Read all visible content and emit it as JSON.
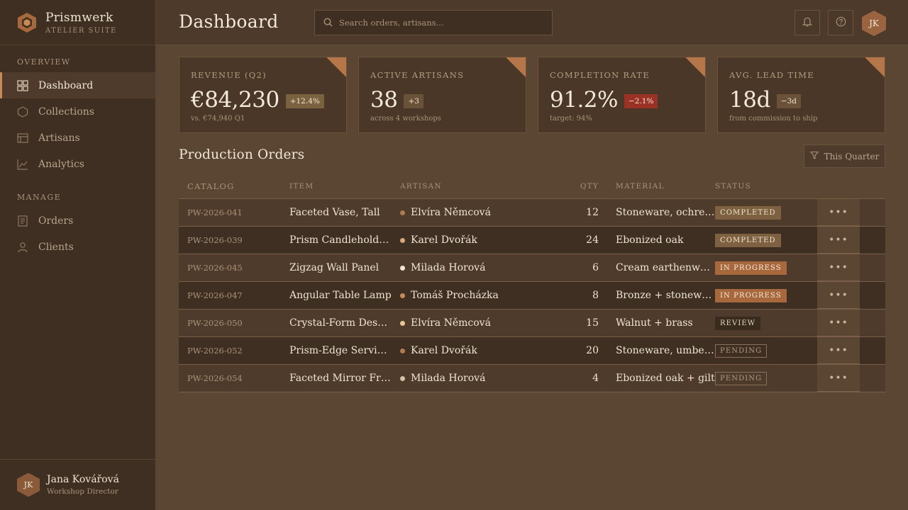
{
  "brand": {
    "name": "Prismwerk",
    "subtitle": "ATELIER SUITE"
  },
  "nav": {
    "overview_label": "OVERVIEW",
    "manage_label": "MANAGE",
    "items": [
      {
        "label": "Dashboard",
        "icon": "grid-icon",
        "active": true
      },
      {
        "label": "Collections",
        "icon": "hexagon-icon"
      },
      {
        "label": "Artisans",
        "icon": "layout-icon"
      },
      {
        "label": "Analytics",
        "icon": "chart-line-icon"
      },
      {
        "label": "Orders",
        "icon": "document-icon"
      },
      {
        "label": "Clients",
        "icon": "user-icon"
      }
    ]
  },
  "user": {
    "initials": "JK",
    "name": "Jana Kovářová",
    "role": "Workshop Director"
  },
  "header": {
    "title": "Dashboard",
    "search_placeholder": "Search orders, artisans...",
    "avatar_initials": "JK"
  },
  "kpis": [
    {
      "label": "REVENUE (Q2)",
      "value": "€84,230",
      "delta": "+12.4%",
      "sub": "vs. €74,940 Q1"
    },
    {
      "label": "ACTIVE ARTISANS",
      "value": "38",
      "delta": "+3",
      "sub": "across 4 workshops"
    },
    {
      "label": "COMPLETION RATE",
      "value": "91.2%",
      "delta": "−2.1%",
      "sub": "target: 94%"
    },
    {
      "label": "AVG. LEAD TIME",
      "value": "18d",
      "delta": "−3d",
      "sub": "from commission to ship"
    }
  ],
  "orders": {
    "title": "Production Orders",
    "filter_label": "This Quarter",
    "columns": [
      "CATALOG",
      "ITEM",
      "ARTISAN",
      "QTY",
      "MATERIAL",
      "STATUS"
    ],
    "rows": [
      {
        "catalog": "PW-2026-041",
        "item": "Faceted Vase, Tall",
        "artisan": "Elvíra Němcová",
        "qty": "12",
        "material": "Stoneware, ochre glaze",
        "status": "COMPLETED"
      },
      {
        "catalog": "PW-2026-039",
        "item": "Prism Candleholder Set",
        "artisan": "Karel Dvořák",
        "qty": "24",
        "material": "Ebonized oak",
        "status": "COMPLETED"
      },
      {
        "catalog": "PW-2026-045",
        "item": "Zigzag Wall Panel",
        "artisan": "Milada Horová",
        "qty": "6",
        "material": "Cream earthenware",
        "status": "IN PROGRESS"
      },
      {
        "catalog": "PW-2026-047",
        "item": "Angular Table Lamp",
        "artisan": "Tomáš Procházka",
        "qty": "8",
        "material": "Bronze + stoneware",
        "status": "IN PROGRESS"
      },
      {
        "catalog": "PW-2026-050",
        "item": "Crystal-Form Desk Object",
        "artisan": "Elvíra Němcová",
        "qty": "15",
        "material": "Walnut + brass",
        "status": "REVIEW"
      },
      {
        "catalog": "PW-2026-052",
        "item": "Prism-Edge Serving Tray",
        "artisan": "Karel Dvořák",
        "qty": "20",
        "material": "Stoneware, umber glaze",
        "status": "PENDING"
      },
      {
        "catalog": "PW-2026-054",
        "item": "Faceted Mirror Frame",
        "artisan": "Milada Horová",
        "qty": "4",
        "material": "Ebonized oak + gilt",
        "status": "PENDING"
      }
    ]
  },
  "colors": {
    "accent": "#c88a55",
    "artisan_dots": [
      "#b07a52",
      "#d6a878",
      "#f1e6d4",
      "#c88a5a",
      "#e6c896",
      "#b07a52",
      "#d2c2a8"
    ]
  }
}
